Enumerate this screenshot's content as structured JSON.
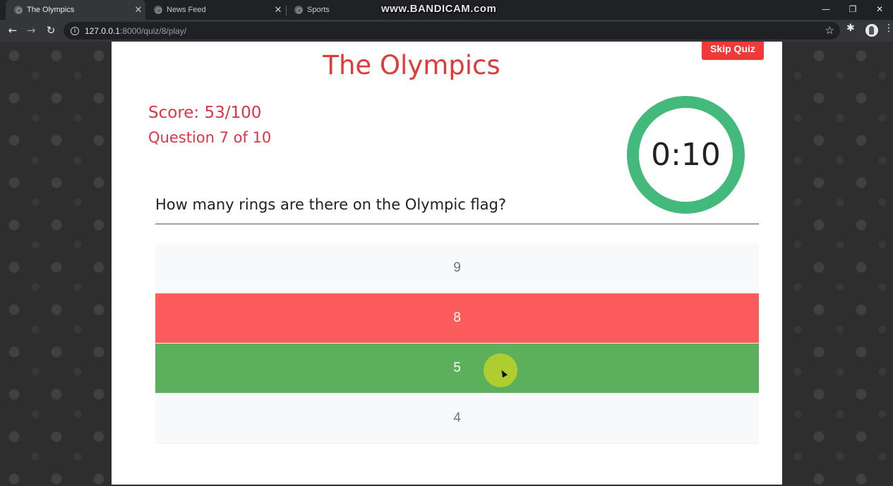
{
  "browser": {
    "tabs": [
      {
        "title": "The Olympics",
        "active": true
      },
      {
        "title": "News Feed",
        "active": false
      },
      {
        "title": "Sports",
        "active": false
      }
    ],
    "watermark": "www.BANDICAM.com",
    "url_host": "127.0.0.1",
    "url_path": ":8000/quiz/8/play/",
    "icons": [
      "back-icon",
      "forward-icon",
      "reload-icon",
      "info-icon",
      "star-icon",
      "extensions-icon",
      "profile-avatar",
      "menu-icon"
    ]
  },
  "quiz": {
    "title": "The Olympics",
    "skip_label": "Skip Quiz",
    "score": "Score: 53/100",
    "progress": "Question 7 of 10",
    "timer": "0:10",
    "question": "How many rings are there on the Olympic flag?",
    "answers": [
      {
        "label": "9",
        "state": "neutral"
      },
      {
        "label": "8",
        "state": "wrong"
      },
      {
        "label": "5",
        "state": "correct"
      },
      {
        "label": "4",
        "state": "neutral"
      }
    ],
    "colors": {
      "accent_red": "#e03b3b",
      "timer_ring": "#43b97c",
      "wrong": "#fd5c5c",
      "correct": "#5cb05c",
      "skip_button": "#f03a3a"
    }
  }
}
